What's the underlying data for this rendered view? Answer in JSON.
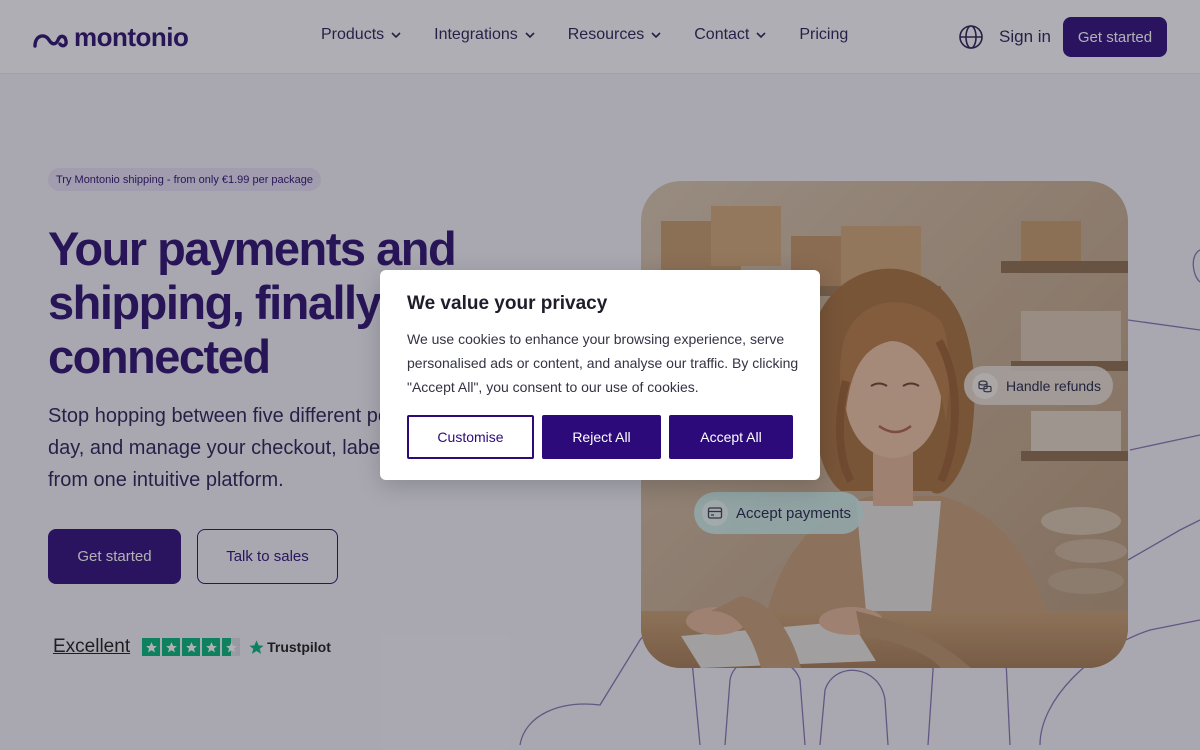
{
  "header": {
    "logo_text": "montonio",
    "nav": [
      {
        "label": "Products",
        "has_dropdown": true
      },
      {
        "label": "Integrations",
        "has_dropdown": true
      },
      {
        "label": "Resources",
        "has_dropdown": true
      },
      {
        "label": "Contact",
        "has_dropdown": true
      },
      {
        "label": "Pricing",
        "has_dropdown": false
      }
    ],
    "language_icon": "globe-icon",
    "sign_in": "Sign in",
    "cta": "Get started"
  },
  "hero": {
    "promo": "Try Montonio shipping - from only €1.99 per package",
    "title_lines": [
      "Your payments and",
      "shipping, finally",
      "connected"
    ],
    "subtitle_lines": [
      "Stop hopping between five different pe",
      "day, and manage your checkout, labels",
      "from one intuitive platform."
    ],
    "primary_button": "Get started",
    "secondary_button": "Talk to sales"
  },
  "trustpilot": {
    "rating_text": "Excellent",
    "rating_stars": 4.5,
    "brand": "Trustpilot"
  },
  "image_chips": {
    "refunds": {
      "label": "Handle refunds",
      "icon": "coins-icon"
    },
    "payments": {
      "label": "Accept payments",
      "icon": "credit-card-icon"
    }
  },
  "cookie_modal": {
    "title": "We value your privacy",
    "body": "We use cookies to enhance your browsing experience, serve personalised ads or content, and analyse our traffic. By clicking \"Accept All\", you consent to our use of cookies.",
    "buttons": {
      "customise": "Customise",
      "reject": "Reject All",
      "accept": "Accept All"
    }
  },
  "colors": {
    "brand": "#2c0a7a",
    "trustpilot_green": "#00b67a"
  }
}
